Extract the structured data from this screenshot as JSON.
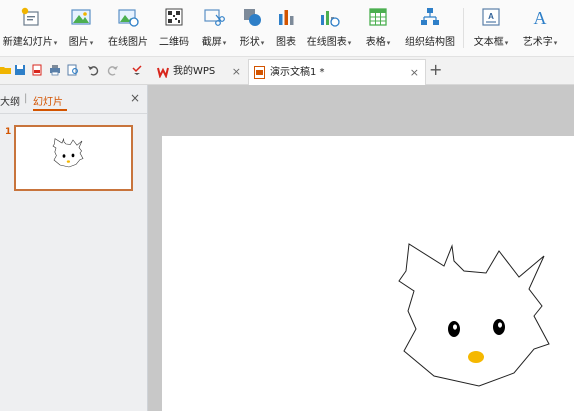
{
  "ribbon": {
    "items": [
      {
        "label": "新建幻灯片",
        "has_dropdown": true,
        "icon": "new-slide-icon"
      },
      {
        "label": "图片",
        "has_dropdown": true,
        "icon": "picture-icon"
      },
      {
        "label": "在线图片",
        "has_dropdown": false,
        "icon": "online-picture-icon"
      },
      {
        "label": "二维码",
        "has_dropdown": false,
        "icon": "qrcode-icon"
      },
      {
        "label": "截屏",
        "has_dropdown": true,
        "icon": "screenshot-icon"
      },
      {
        "label": "形状",
        "has_dropdown": true,
        "icon": "shapes-icon"
      },
      {
        "label": "图表",
        "has_dropdown": false,
        "icon": "chart-icon"
      },
      {
        "label": "在线图表",
        "has_dropdown": true,
        "icon": "online-chart-icon"
      },
      {
        "label": "表格",
        "has_dropdown": true,
        "icon": "table-icon"
      },
      {
        "label": "组织结构图",
        "has_dropdown": false,
        "icon": "org-chart-icon"
      },
      {
        "label": "文本框",
        "has_dropdown": true,
        "icon": "textbox-icon"
      },
      {
        "label": "艺术字",
        "has_dropdown": true,
        "icon": "wordart-icon"
      }
    ],
    "dropdown_glyph": "▾"
  },
  "tabs": {
    "wps_tab": {
      "label": "我的WPS",
      "close": "×"
    },
    "doc_tab": {
      "label": "演示文稿1 *",
      "close": "×"
    },
    "add": "+"
  },
  "sidebar": {
    "tab_outline": "大纲",
    "divider": "|",
    "tab_slides": "幻灯片",
    "close": "×",
    "slide_number": "1"
  },
  "colors": {
    "accent": "#d35400",
    "thumb_border": "#c8743c",
    "cat_nose": "#f5b800",
    "wps_red": "#d8261c"
  }
}
